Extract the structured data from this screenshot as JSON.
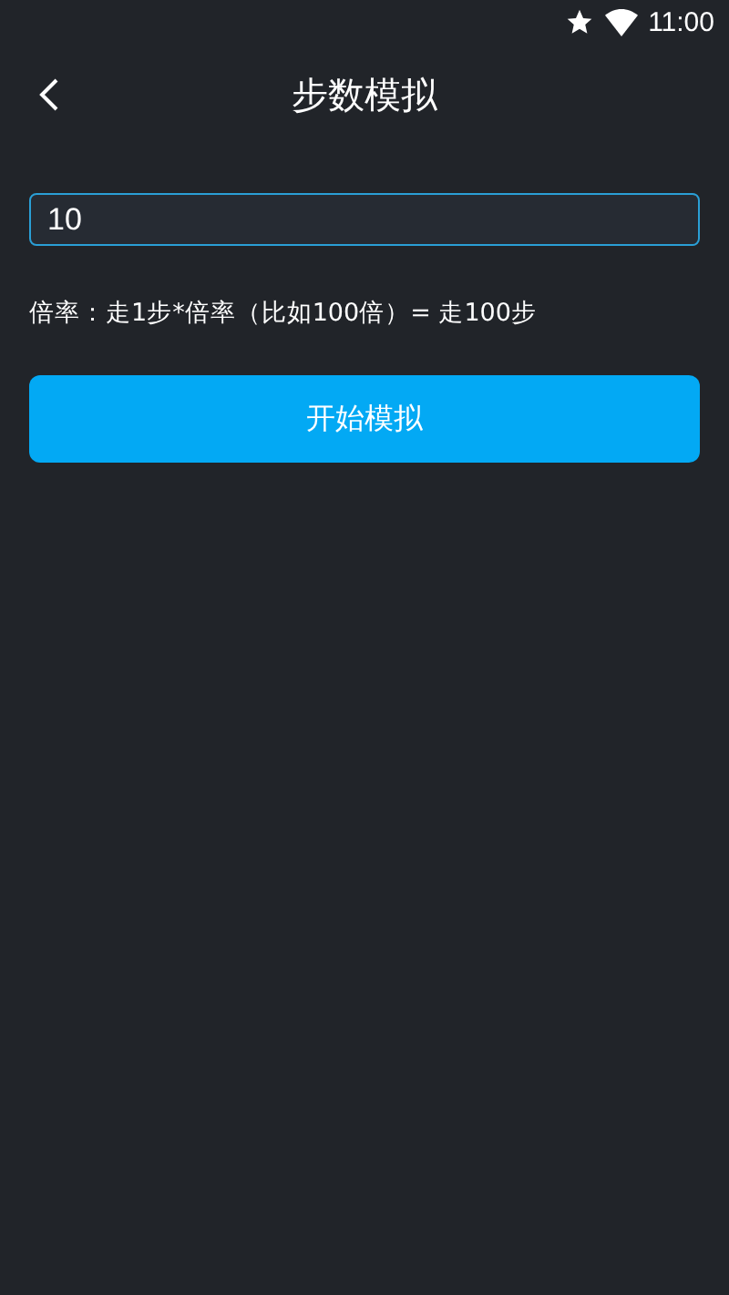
{
  "status_bar": {
    "time": "11:00"
  },
  "header": {
    "title": "步数模拟"
  },
  "multiplier_field": {
    "value": "10"
  },
  "hint": "倍率：走1步*倍率（比如100倍）= 走100步",
  "start_button": {
    "label": "开始模拟"
  }
}
